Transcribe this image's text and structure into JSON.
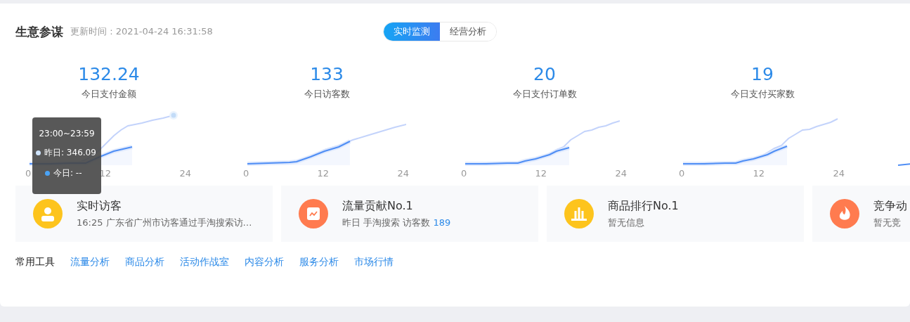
{
  "header": {
    "title": "生意参谋",
    "updated": "更新时间 : 2021-04-24 16:31:58"
  },
  "tabs": [
    {
      "label": "实时监测",
      "selected": true
    },
    {
      "label": "经营分析",
      "selected": false
    }
  ],
  "metrics": [
    {
      "kind": "full",
      "value": "132.24",
      "label": "今日支付金额",
      "ticks": [
        "0",
        "12",
        "24"
      ],
      "tooltip": {
        "title": "23:00~23:59",
        "rows": [
          {
            "text": "昨日: 346.09",
            "color": "#cfe3fb"
          },
          {
            "text": "今日: --",
            "color": "#4aa3f5"
          }
        ]
      }
    },
    {
      "kind": "full",
      "value": "133",
      "label": "今日访客数",
      "ticks": [
        "0",
        "12",
        "24"
      ]
    },
    {
      "kind": "full",
      "value": "20",
      "label": "今日支付订单数",
      "ticks": [
        "0",
        "12",
        "24"
      ]
    },
    {
      "kind": "full",
      "value": "19",
      "label": "今日支付买家数",
      "ticks": [
        "0",
        "12",
        "24"
      ]
    },
    {
      "kind": "clipped"
    }
  ],
  "cards": [
    {
      "title": "实时访客",
      "text": "16:25 广东省广州市访客通过手淘搜索访…",
      "color": "#fdc41d"
    },
    {
      "title": "流量贡献No.1",
      "text": "昨日 手淘搜索 访客数",
      "count": "189",
      "color": "#ff7b4f"
    },
    {
      "title": "商品排行No.1",
      "text": "暂无信息",
      "color": "#fdc41d"
    },
    {
      "title": "竞争动",
      "text": "暂无竞",
      "color": "#ff7b4f"
    }
  ],
  "tools": {
    "label": "常用工具",
    "links": [
      "流量分析",
      "商品分析",
      "活动作战室",
      "内容分析",
      "服务分析",
      "市场行情"
    ]
  }
}
